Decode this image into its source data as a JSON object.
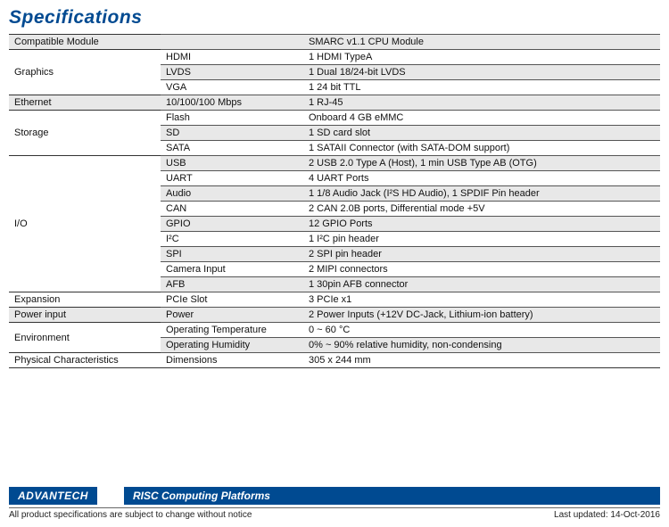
{
  "title": "Specifications",
  "rows": [
    {
      "cat": "Compatible Module",
      "sub": "",
      "val": "SMARC v1.1 CPU Module",
      "shade": true,
      "newsect": true
    },
    {
      "cat": "Graphics",
      "sub": "HDMI",
      "val": "1 HDMI TypeA",
      "newsect": true
    },
    {
      "cat": "",
      "sub": "LVDS",
      "val": "1 Dual 18/24-bit LVDS",
      "shade": true,
      "cont": true
    },
    {
      "cat": "",
      "sub": "VGA",
      "val": "1 24 bit TTL",
      "cont": true
    },
    {
      "cat": "Ethernet",
      "sub": "10/100/100 Mbps",
      "val": "1 RJ-45",
      "shade": true,
      "newsect": true
    },
    {
      "cat": "Storage",
      "sub": "Flash",
      "val": "Onboard 4 GB eMMC",
      "newsect": true
    },
    {
      "cat": "",
      "sub": "SD",
      "val": "1 SD card slot",
      "shade": true,
      "cont": true
    },
    {
      "cat": "",
      "sub": "SATA",
      "val": "1 SATAII Connector (with SATA-DOM support)",
      "cont": true
    },
    {
      "cat": "I/O",
      "sub": "USB",
      "val": "2 USB 2.0 Type A (Host), 1 min USB Type AB (OTG)",
      "shade": true,
      "newsect": true
    },
    {
      "cat": "",
      "sub": "UART",
      "val": "4 UART Ports",
      "cont": true
    },
    {
      "cat": "",
      "sub": "Audio",
      "val": "1 1/8 Audio Jack (I²S HD Audio), 1 SPDIF Pin header",
      "shade": true,
      "cont": true
    },
    {
      "cat": "",
      "sub": "CAN",
      "val": "2 CAN 2.0B ports, Differential mode +5V",
      "cont": true
    },
    {
      "cat": "",
      "sub": "GPIO",
      "val": "12 GPIO Ports",
      "shade": true,
      "cont": true
    },
    {
      "cat": "",
      "sub": "I²C",
      "val": "1 I²C pin header",
      "cont": true
    },
    {
      "cat": "",
      "sub": "SPI",
      "val": "2 SPI pin header",
      "shade": true,
      "cont": true
    },
    {
      "cat": "",
      "sub": "Camera Input",
      "val": "2 MIPI connectors",
      "cont": true
    },
    {
      "cat": "",
      "sub": "AFB",
      "val": "1 30pin AFB connector",
      "shade": true,
      "cont": true
    },
    {
      "cat": "Expansion",
      "sub": "PCIe Slot",
      "val": "3 PCIe x1",
      "newsect": true
    },
    {
      "cat": "Power input",
      "sub": "Power",
      "val": "2 Power Inputs (+12V DC-Jack, Lithium-ion battery)",
      "shade": true,
      "newsect": true
    },
    {
      "cat": "Environment",
      "sub": "Operating Temperature",
      "val": "0 ~ 60 °C",
      "newsect": true
    },
    {
      "cat": "",
      "sub": "Operating Humidity",
      "val": "0% ~ 90% relative humidity, non-condensing",
      "shade": true,
      "cont": true
    },
    {
      "cat": "Physical Characteristics",
      "sub": "Dimensions",
      "val": "305 x 244 mm",
      "newsect": true,
      "lastborder": true
    }
  ],
  "footer": {
    "brand": "ADVANTECH",
    "category": "RISC Computing Platforms",
    "notice": "All product specifications are subject to change without notice",
    "updated": "Last updated: 14-Oct-2016"
  }
}
